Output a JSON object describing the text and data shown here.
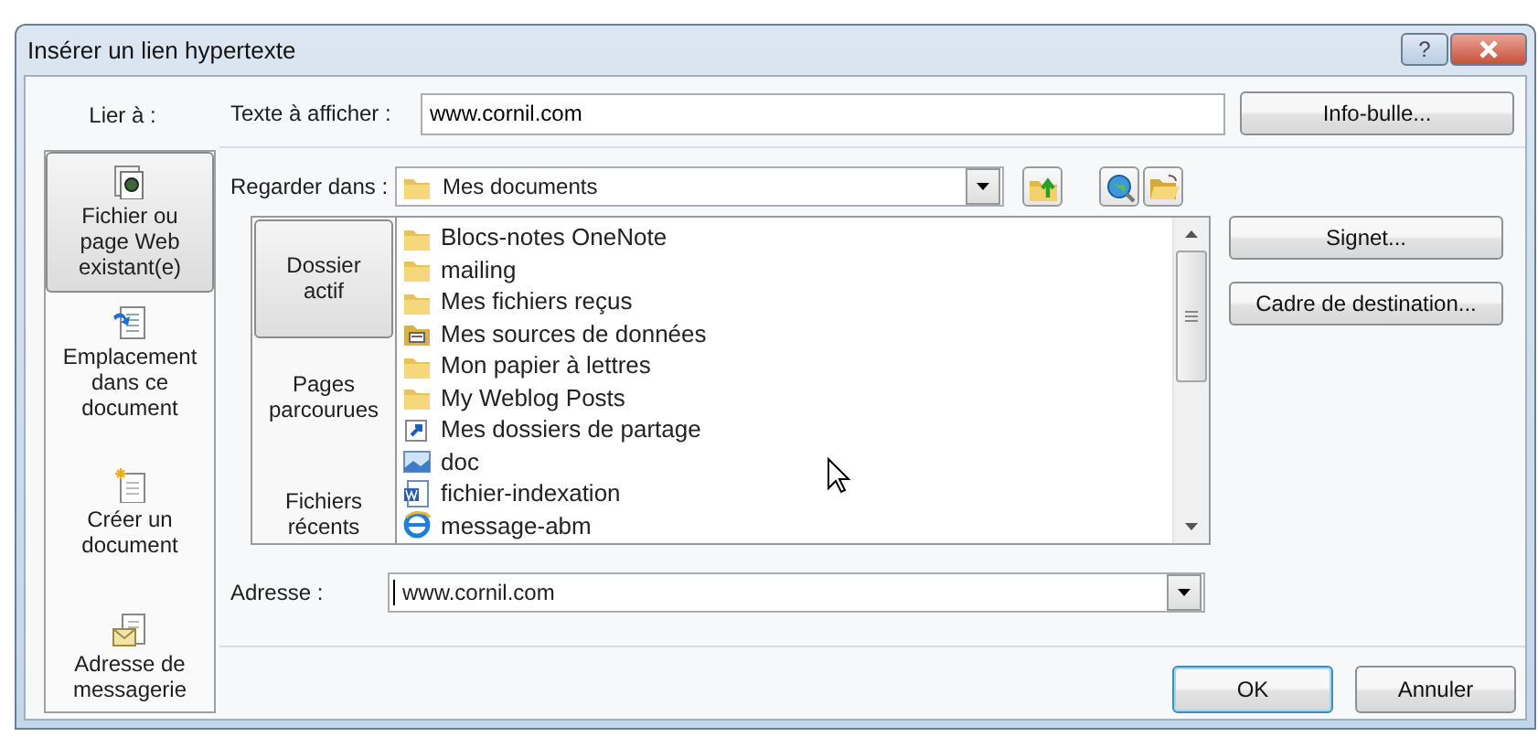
{
  "window": {
    "title": "Insérer un lien hypertexte",
    "controls": [
      {
        "kind": "help",
        "label": "?"
      },
      {
        "kind": "close"
      }
    ]
  },
  "link_to": {
    "label": "Lier à :",
    "items": [
      {
        "label": "Fichier ou\npage Web\nexistant(e)",
        "kind": "file",
        "selected": true
      },
      {
        "label": "Emplacement\ndans ce\ndocument",
        "kind": "place",
        "selected": false
      },
      {
        "label": "Créer un\ndocument",
        "kind": "new",
        "selected": false
      },
      {
        "label": "Adresse de\nmessagerie",
        "kind": "mail",
        "selected": false
      }
    ]
  },
  "text_to_display": {
    "label": "Texte à afficher :",
    "value": "www.cornil.com"
  },
  "look_in": {
    "label": "Regarder dans :",
    "value": "Mes documents"
  },
  "browse_tabs": [
    {
      "label": "Dossier\nactif",
      "selected": true
    },
    {
      "label": "Pages\nparcourues",
      "selected": false
    },
    {
      "label": "Fichiers\nrécents",
      "selected": false
    }
  ],
  "files": [
    {
      "name": "Blocs-notes OneNote",
      "kind": "folder"
    },
    {
      "name": "mailing",
      "kind": "folder"
    },
    {
      "name": "Mes fichiers reçus",
      "kind": "folder"
    },
    {
      "name": "Mes sources de données",
      "kind": "datasource"
    },
    {
      "name": "Mon papier à lettres",
      "kind": "folder"
    },
    {
      "name": "My Weblog Posts",
      "kind": "folder"
    },
    {
      "name": "Mes dossiers de partage",
      "kind": "shortcut"
    },
    {
      "name": "doc",
      "kind": "image"
    },
    {
      "name": "fichier-indexation",
      "kind": "word"
    },
    {
      "name": "message-abm",
      "kind": "web"
    }
  ],
  "side_buttons": [
    "Info-bulle...",
    "Signet...",
    "Cadre de destination..."
  ],
  "address": {
    "label": "Adresse :",
    "value": "www.cornil.com"
  },
  "buttons": [
    {
      "label": "OK",
      "default": true
    },
    {
      "label": "Annuler",
      "default": false
    }
  ]
}
